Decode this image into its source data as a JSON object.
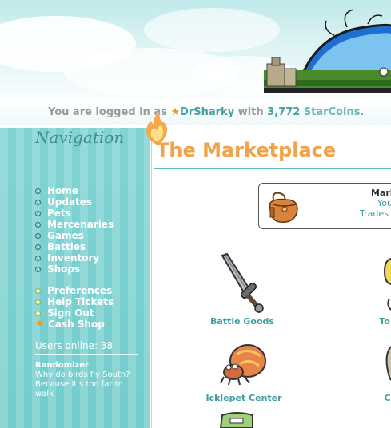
{
  "status": {
    "prefix": "You are logged in as ",
    "username": "DrSharky",
    "mid": " with ",
    "coins": "3,772",
    "currency": " StarCoins."
  },
  "nav": {
    "title": "Navigation",
    "items": [
      {
        "label": "Home"
      },
      {
        "label": "Updates"
      },
      {
        "label": "Pets"
      },
      {
        "label": "Mercenaries"
      },
      {
        "label": "Games"
      },
      {
        "label": "Battles"
      },
      {
        "label": "Inventory"
      },
      {
        "label": "Shops"
      }
    ],
    "account_items": [
      {
        "label": "Preferences"
      },
      {
        "label": "Help Tickets"
      },
      {
        "label": "Sign Out"
      },
      {
        "label": "Cash Shop",
        "icon": "star-icon"
      }
    ],
    "users_online": "Users online: 38",
    "randomizer": {
      "title": "Randomizer",
      "text": "Why do birds fly South? Because it's too far to walk"
    }
  },
  "main": {
    "title": "The Marketplace",
    "info_box": {
      "title": "Mark",
      "line1": "You",
      "line2": "Trades"
    },
    "shops": [
      {
        "label": "Battle Goods",
        "icon": "sword-icon"
      },
      {
        "label": "To",
        "icon": "partial-item-icon"
      },
      {
        "label": "Icklepet Center",
        "icon": "hermit-crab-icon"
      },
      {
        "label": "C",
        "icon": "partial-item-icon"
      }
    ]
  },
  "colors": {
    "accent_title": "#f0a34a",
    "link_teal": "#3f9fa3",
    "sidebar_bg": "#7fd3d3",
    "coin_star": "#e59b1c"
  }
}
